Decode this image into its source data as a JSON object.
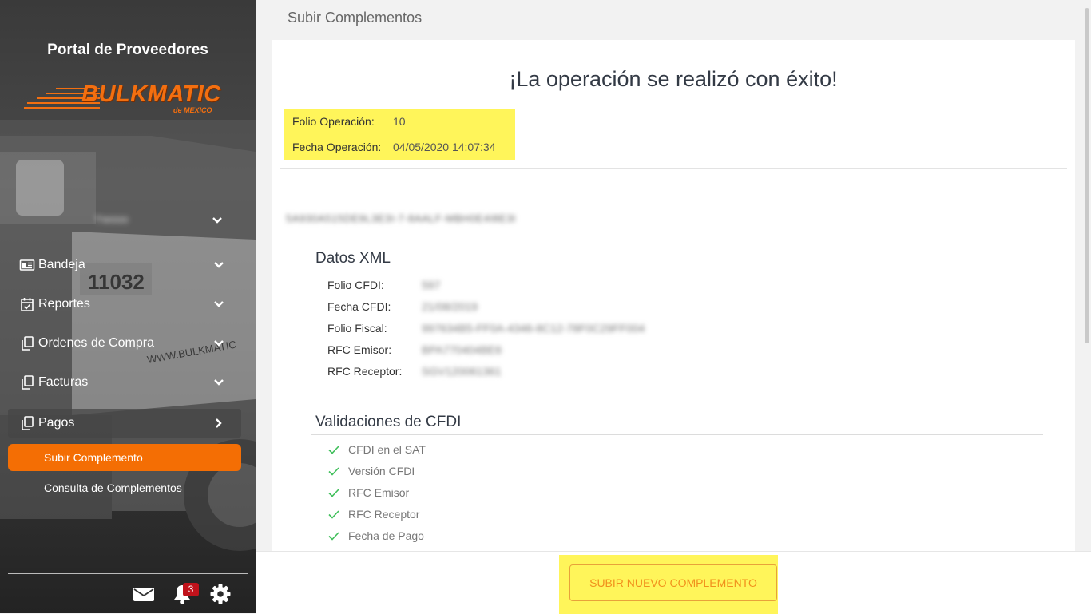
{
  "sidebar": {
    "portal_title": "Portal de Proveedores",
    "logo_text": "BULKMATIC",
    "logo_sub": "de MEXICO",
    "user_name": "Ywooo",
    "nav": [
      {
        "label": "Bandeja",
        "icon": "newspaper-icon"
      },
      {
        "label": "Reportes",
        "icon": "calendar-check-icon"
      },
      {
        "label": "Ordenes de Compra",
        "icon": "copy-icon"
      },
      {
        "label": "Facturas",
        "icon": "copy-icon"
      },
      {
        "label": "Pagos",
        "icon": "copy-icon"
      }
    ],
    "sub_items": [
      "Subir Complemento",
      "Consulta de Complementos"
    ],
    "notification_count": "3",
    "accent_color": "#f46e04"
  },
  "main": {
    "page_heading": "Subir Complementos",
    "success_title": "¡La operación se realizó con éxito!",
    "operation": {
      "folio_label": "Folio Operación:",
      "folio_value": "10",
      "fecha_label": "Fecha Operación:",
      "fecha_value": "04/05/2020 14:07:34"
    },
    "file_name": "5A930A515DE9L3E3I-7-8AALF-MBH0E4I8E3I",
    "xml": {
      "title": "Datos XML",
      "rows": [
        {
          "label": "Folio CFDI:",
          "value": "597"
        },
        {
          "label": "Fecha CFDI:",
          "value": "21/08/2019"
        },
        {
          "label": "Folio Fiscal:",
          "value": "997634B5-FF0A-4346-8C12-78F0C29FF004"
        },
        {
          "label": "RFC Emisor:",
          "value": "BPA770404BE6"
        },
        {
          "label": "RFC Receptor:",
          "value": "SGV120061361"
        }
      ]
    },
    "validations": {
      "title": "Validaciones de CFDI",
      "items": [
        "CFDI en el SAT",
        "Versión CFDI",
        "RFC Emisor",
        "RFC Receptor",
        "Fecha de Pago"
      ]
    },
    "button_label": "SUBIR NUEVO COMPLEMENTO",
    "highlight_color": "#fff55a"
  }
}
